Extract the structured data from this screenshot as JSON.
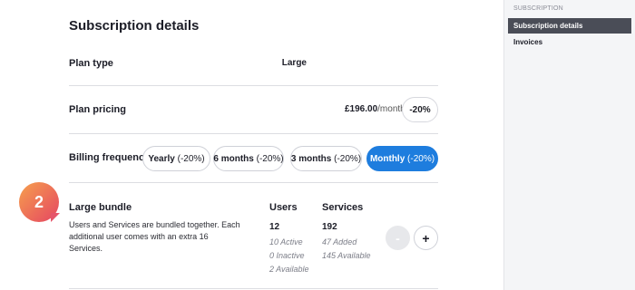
{
  "page": {
    "title": "Subscription details"
  },
  "plan_type": {
    "label": "Plan type",
    "value": "Large"
  },
  "plan_pricing": {
    "label": "Plan pricing",
    "amount": "£196.00",
    "per": "/month",
    "discount": "-20%"
  },
  "billing": {
    "label": "Billing frequency",
    "options": [
      {
        "name": "Yearly",
        "pct": "(-20%)",
        "active": false
      },
      {
        "name": "6 months",
        "pct": "(-20%)",
        "active": false
      },
      {
        "name": "3 months",
        "pct": "(-20%)",
        "active": false
      },
      {
        "name": "Monthly",
        "pct": "(-20%)",
        "active": true
      }
    ]
  },
  "bundle": {
    "step": "2",
    "title": "Large bundle",
    "description": "Users and Services are bundled together. Each additional user comes with an extra 16 Services.",
    "users": {
      "label": "Users",
      "total": "12",
      "active": "10 Active",
      "inactive": "0 Inactive",
      "available": "2 Available"
    },
    "services": {
      "label": "Services",
      "total": "192",
      "added": "47 Added",
      "available": "145 Available"
    },
    "minus": "-",
    "plus": "+"
  },
  "sidebar": {
    "section": "SUBSCRIPTION",
    "items": [
      {
        "label": "Subscription details",
        "active": true
      },
      {
        "label": "Invoices",
        "active": false
      }
    ]
  },
  "colors": {
    "accent": "#1e7dde",
    "badge_start": "#f6a04d",
    "badge_end": "#e54562",
    "sidebar_active": "#4a4d57"
  }
}
